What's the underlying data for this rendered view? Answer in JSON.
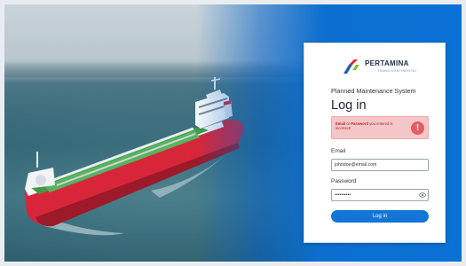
{
  "brand": {
    "name": "PERTAMINA",
    "subname": "TRANS KONTINENTAL",
    "colors": {
      "red": "#e0262d",
      "blue": "#1a5fb4",
      "green": "#7fbf3f"
    }
  },
  "app_subtitle": "Planned Maintenance System",
  "login": {
    "title": "Log in",
    "error": {
      "bold1": "Email",
      "mid": " or ",
      "bold2": "Password",
      "rest": " you entered is incorrect!",
      "icon": "exclamation-icon"
    },
    "email": {
      "label": "Email",
      "value": "johndoe@email.com"
    },
    "password": {
      "label": "Password",
      "value": "••••••••••",
      "icon": "eye-icon"
    },
    "submit_label": "Log in"
  },
  "colors": {
    "accent": "#1475d6",
    "error_bg": "#f5c6c8",
    "error_text": "#b3262d"
  }
}
